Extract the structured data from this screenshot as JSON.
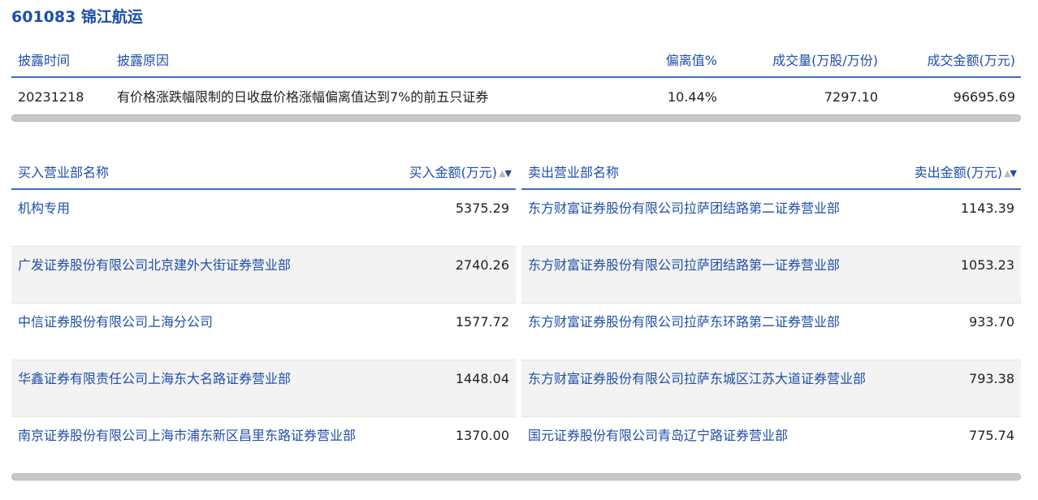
{
  "title": "601083 锦江航运",
  "disclosure": {
    "headers": {
      "time": "披露时间",
      "reason": "披露原因",
      "deviation": "偏离值%",
      "volume": "成交量(万股/万份)",
      "amount": "成交金额(万元)"
    },
    "row": {
      "time": "20231218",
      "reason": "有价格涨跌幅限制的日收盘价格涨幅偏离值达到7%的前五只证券",
      "deviation": "10.44%",
      "volume": "7297.10",
      "amount": "96695.69"
    }
  },
  "buy": {
    "header_name": "买入营业部名称",
    "header_amount": "买入金额(万元)",
    "sort_icons": {
      "up": "▲",
      "down": "▼"
    },
    "rows": [
      {
        "name": "机构专用",
        "amount": "5375.29"
      },
      {
        "name": "广发证券股份有限公司北京建外大街证券营业部",
        "amount": "2740.26"
      },
      {
        "name": "中信证券股份有限公司上海分公司",
        "amount": "1577.72"
      },
      {
        "name": "华鑫证券有限责任公司上海东大名路证券营业部",
        "amount": "1448.04"
      },
      {
        "name": "南京证券股份有限公司上海市浦东新区昌里东路证券营业部",
        "amount": "1370.00"
      }
    ]
  },
  "sell": {
    "header_name": "卖出营业部名称",
    "header_amount": "卖出金额(万元)",
    "sort_icons": {
      "up": "▲",
      "down": "▼"
    },
    "rows": [
      {
        "name": "东方财富证券股份有限公司拉萨团结路第二证券营业部",
        "amount": "1143.39"
      },
      {
        "name": "东方财富证券股份有限公司拉萨团结路第一证券营业部",
        "amount": "1053.23"
      },
      {
        "name": "东方财富证券股份有限公司拉萨东环路第二证券营业部",
        "amount": "933.70"
      },
      {
        "name": "东方财富证券股份有限公司拉萨东城区江苏大道证券营业部",
        "amount": "793.38"
      },
      {
        "name": "国元证券股份有限公司青岛辽宁路证券营业部",
        "amount": "775.74"
      }
    ]
  },
  "colors": {
    "accent": "#1f4fa8",
    "header_rule": "#3a6cc0",
    "row_alt": "#f3f3f3",
    "scrollbar": "#c8c8c8"
  }
}
